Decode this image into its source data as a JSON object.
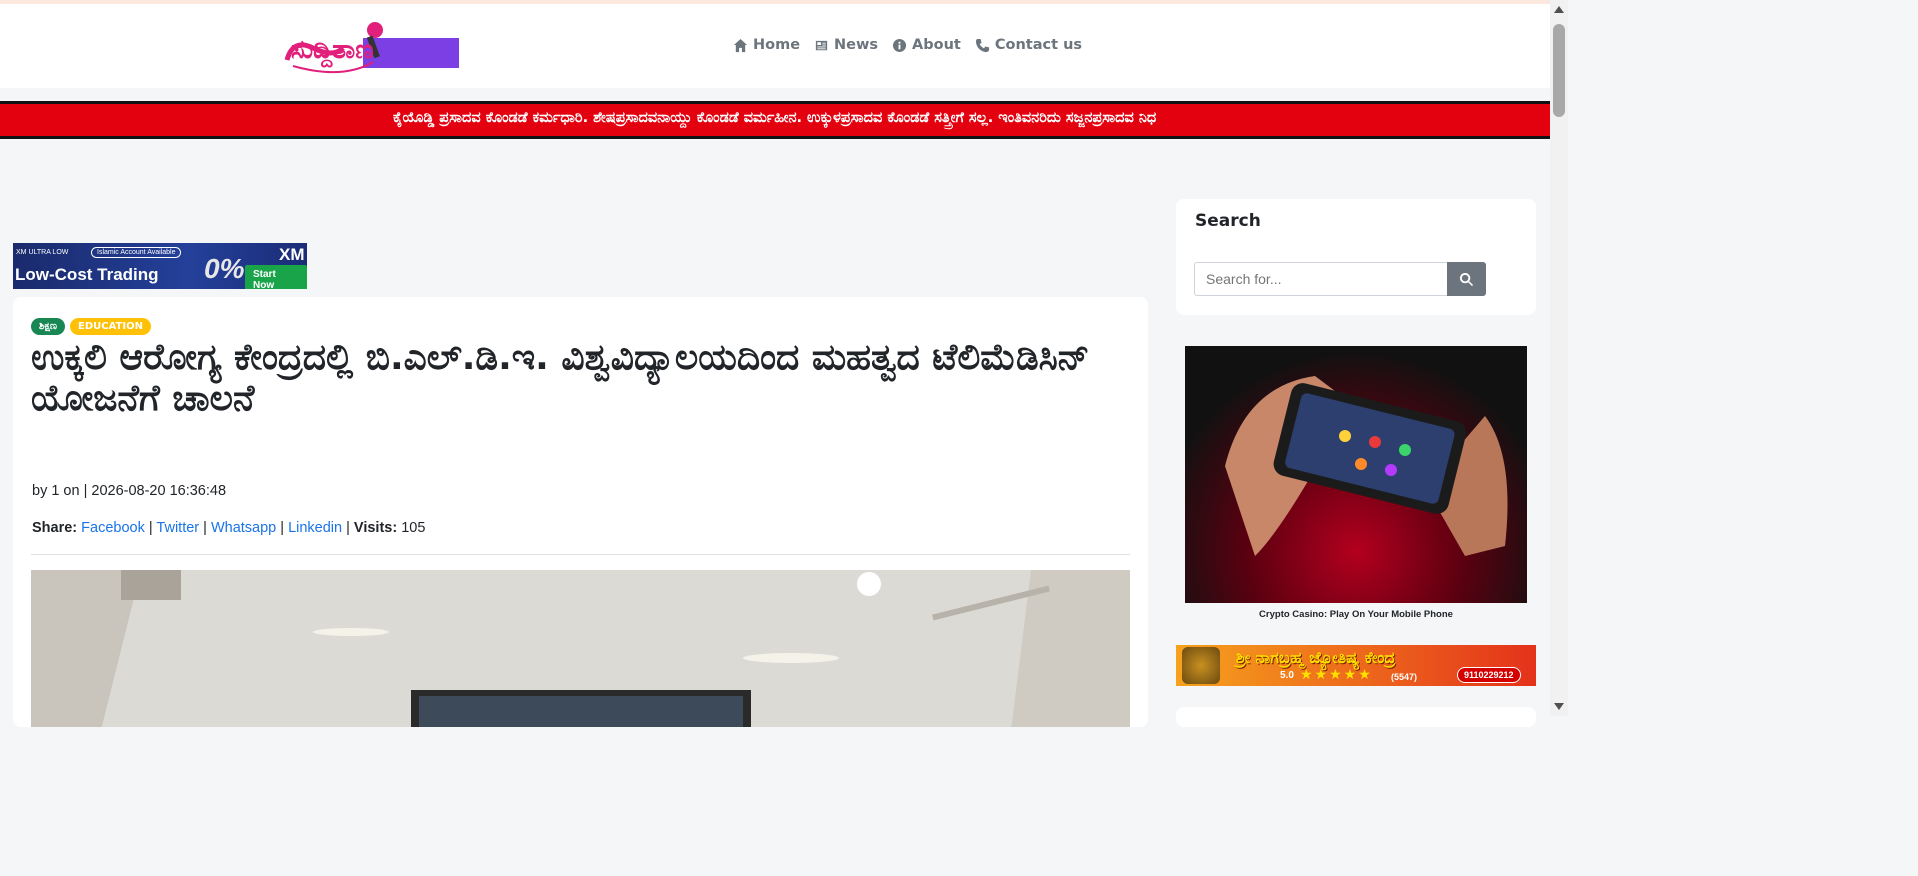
{
  "site": {
    "logo_text": "ಸುದ್ದಿತಾಣ"
  },
  "nav": {
    "items": [
      {
        "label": "Home",
        "icon": "home-icon"
      },
      {
        "label": "News",
        "icon": "newspaper-icon"
      },
      {
        "label": "About",
        "icon": "info-icon"
      },
      {
        "label": "Contact us",
        "icon": "phone-icon"
      }
    ]
  },
  "ticker": {
    "text": "ಕೈಯೊಡ್ಡಿ ಪ್ರಸಾದವ ಕೊಂಡಡೆ ಕರ್ಮಧಾರಿ. ಶೇಷಪ್ರಸಾದವನಾಯ್ದು ಕೊಂಡಡೆ ವರ್ಮಹೀನ. ಉಕ್ಕುಳಪ್ರಸಾದವ ಕೊಂಡಡೆ ಸತ್ತ್ರೀಗೆ ಸಲ್ಲ. ಇಂತಿವನರಿದು ಸಜ್ಜನಪ್ರಸಾದವ ನಿಧ"
  },
  "ad_banner": {
    "small_text": "XM ULTRA LOW",
    "pill_text": "Islamic Account Available",
    "headline": "Low-Cost Trading",
    "percent": "0%",
    "brand": "XM",
    "cta": "Start Now"
  },
  "article": {
    "badges": [
      {
        "label": "ಶಿಕ್ಷಣ",
        "color": "#198754"
      },
      {
        "label": "EDUCATION",
        "color": "#ffc107"
      }
    ],
    "title": "ಉಕ್ಕಲಿ ಆರೋಗ್ಯ ಕೇಂದ್ರದಲ್ಲಿ ಬಿ.ಎಲ್.ಡಿ.ಇ. ವಿಶ್ವವಿದ್ಯಾಲಯದಿಂದ ಮಹತ್ವದ ಟೆಲಿಮೆಡಿಸಿನ್ ಯೋಜನೆಗೆ ಚಾಲನೆ",
    "byline": "by 1 on | 2026-08-20 16:36:48",
    "share_label": "Share:",
    "share_links": [
      "Facebook",
      "Twitter",
      "Whatsapp",
      "Linkedin"
    ],
    "visits_label": "Visits:",
    "visits": "105"
  },
  "sidebar": {
    "search_title": "Search",
    "search_placeholder": "Search for...",
    "ad_caption": "Crypto Casino: Play On Your Mobile Phone",
    "jyotish": {
      "name": "ಶ್ರೀ ನಾಗಬ್ರಹ್ಮ ಜ್ಯೋತಿಷ್ಯ ಕೇಂದ್ರ",
      "rating": "5.0",
      "stars": "★★★★★",
      "count": "(5547)",
      "phone": "9110229212"
    }
  },
  "colors": {
    "ticker_bg": "#e3000f",
    "link": "#1a73e8",
    "badge_green": "#198754",
    "badge_yellow": "#ffc107"
  }
}
